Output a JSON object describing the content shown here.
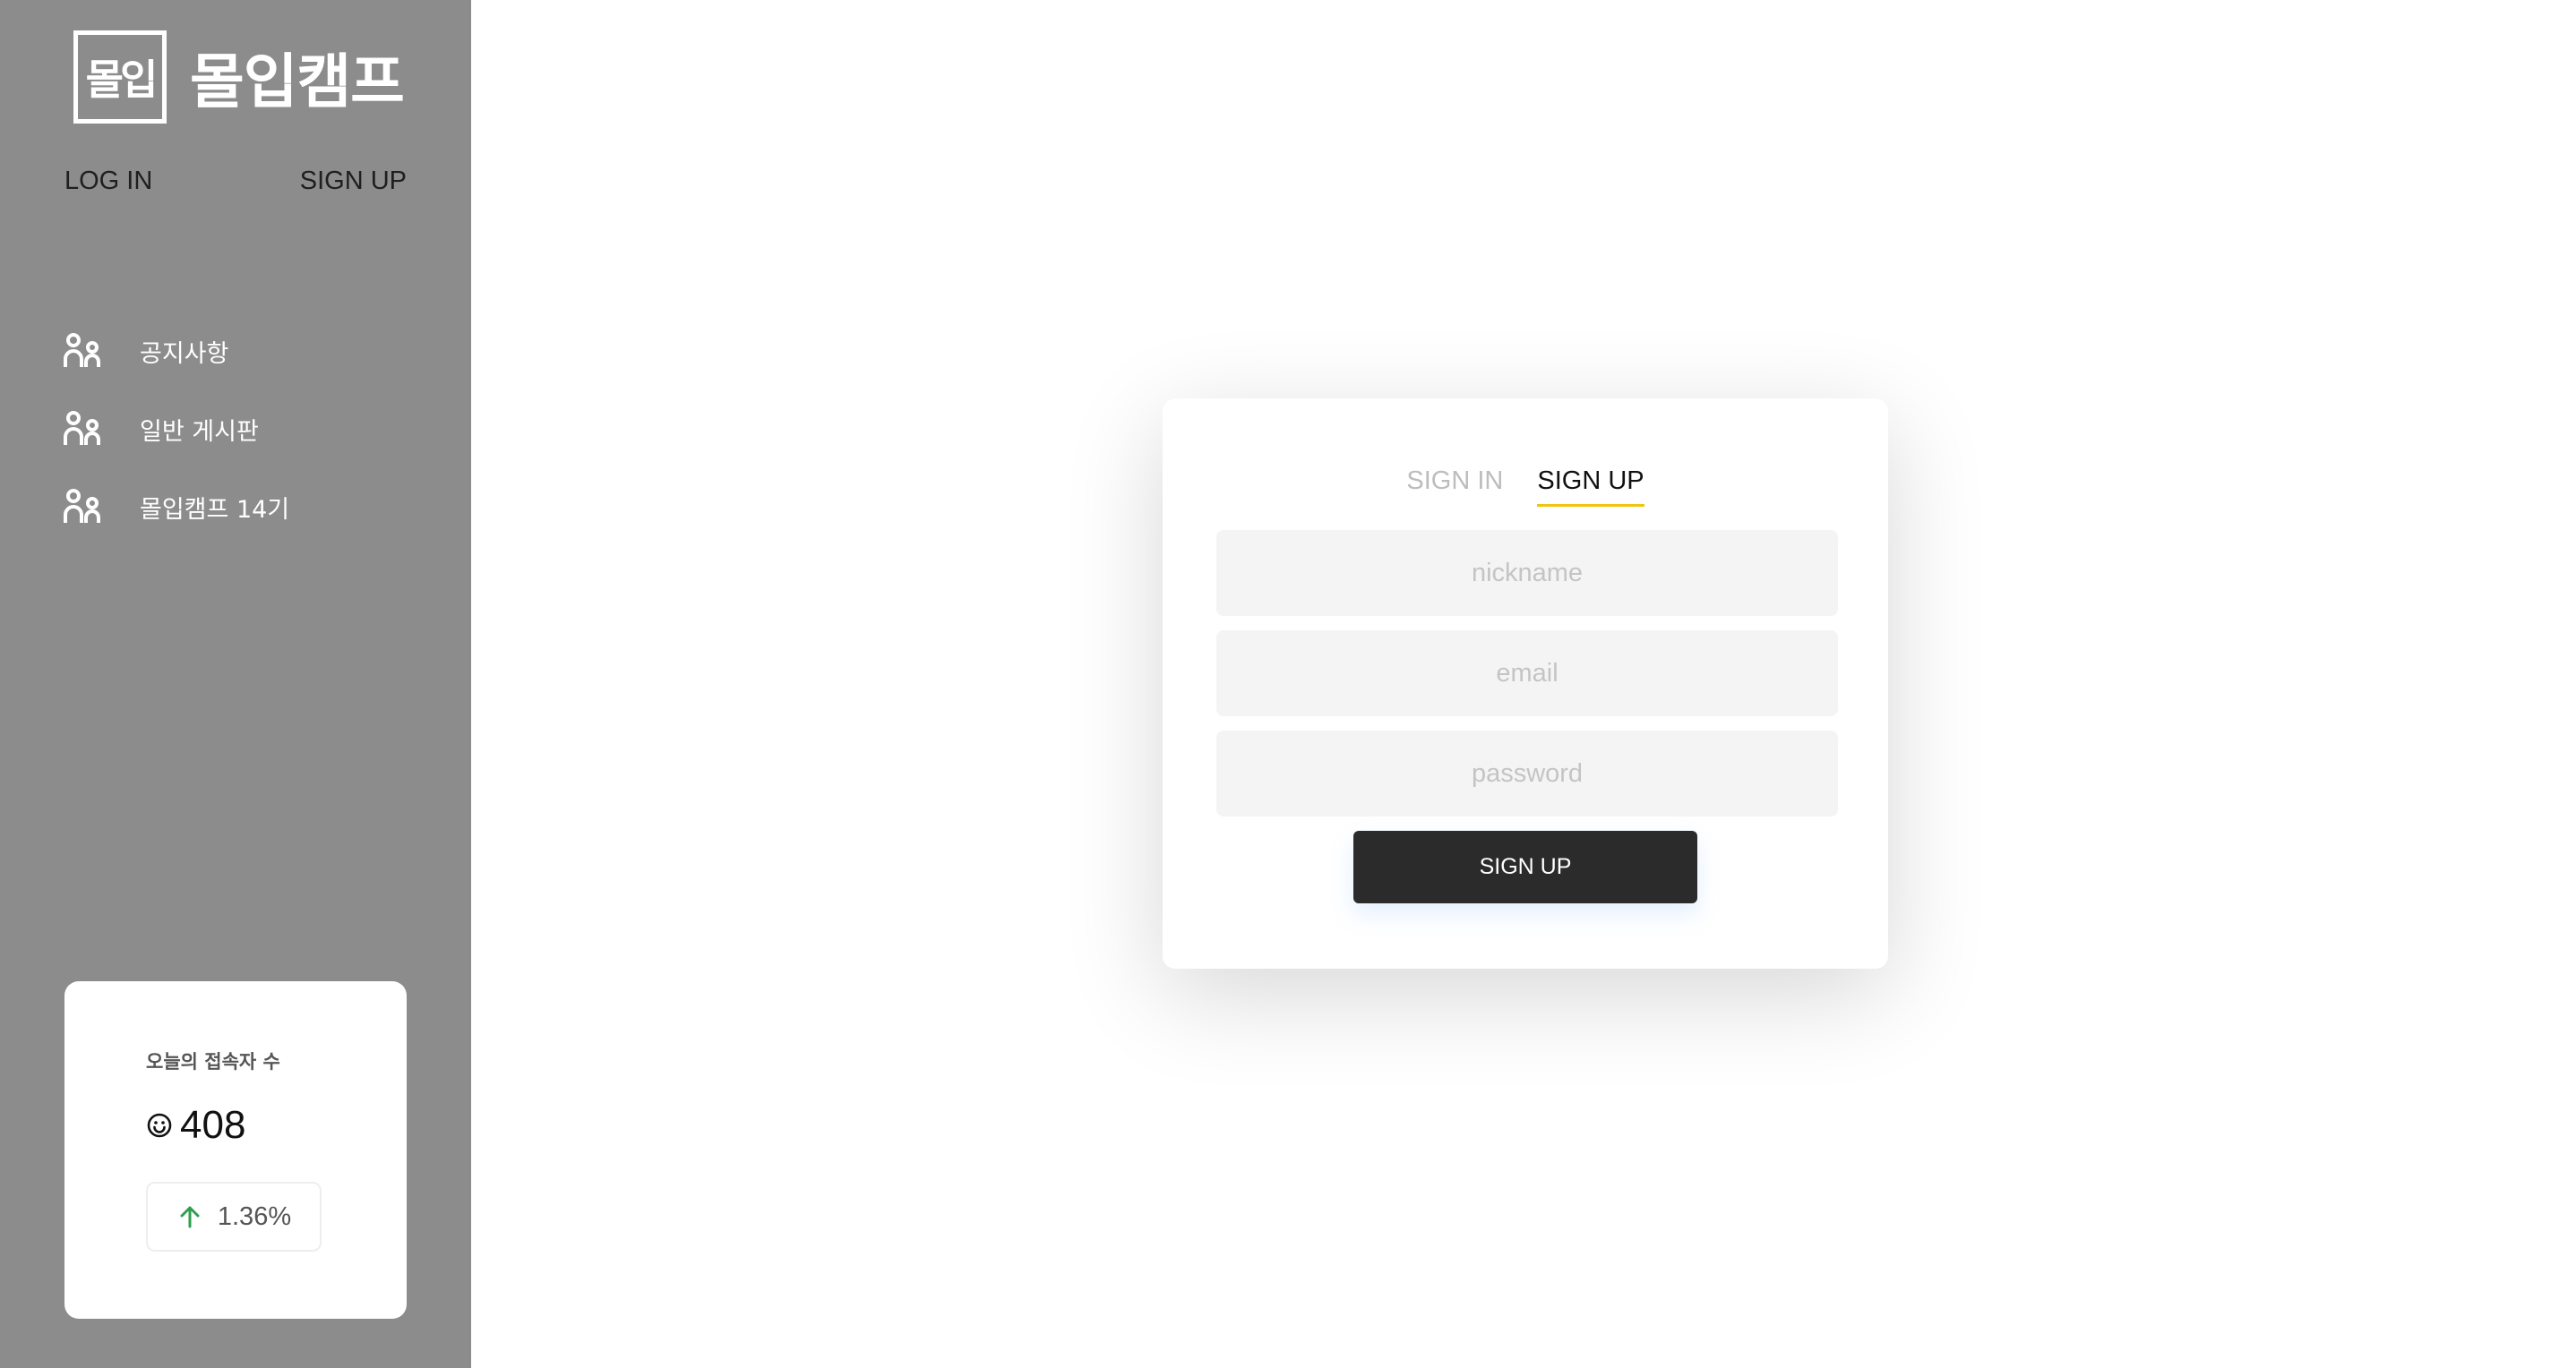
{
  "brand": {
    "logo_mark": "몰입",
    "name": "몰입캠프"
  },
  "auth_links": {
    "login": "LOG IN",
    "signup": "SIGN UP"
  },
  "nav": {
    "items": [
      {
        "label": "공지사항",
        "icon": "people-icon"
      },
      {
        "label": "일반 게시판",
        "icon": "people-icon"
      },
      {
        "label": "몰입캠프 14기",
        "icon": "people-icon"
      }
    ]
  },
  "visitors": {
    "title": "오늘의 접속자 수",
    "count": "408",
    "change": "1.36%",
    "icon": "smile-icon",
    "trend_icon": "arrow-up-icon",
    "trend_color": "#2e9e4f"
  },
  "form": {
    "tabs": [
      {
        "label": "SIGN IN",
        "active": false
      },
      {
        "label": "SIGN UP",
        "active": true
      }
    ],
    "fields": {
      "nickname_placeholder": "nickname",
      "email_placeholder": "email",
      "password_placeholder": "password"
    },
    "submit_label": "SIGN UP",
    "accent_color": "#f1c40f"
  }
}
